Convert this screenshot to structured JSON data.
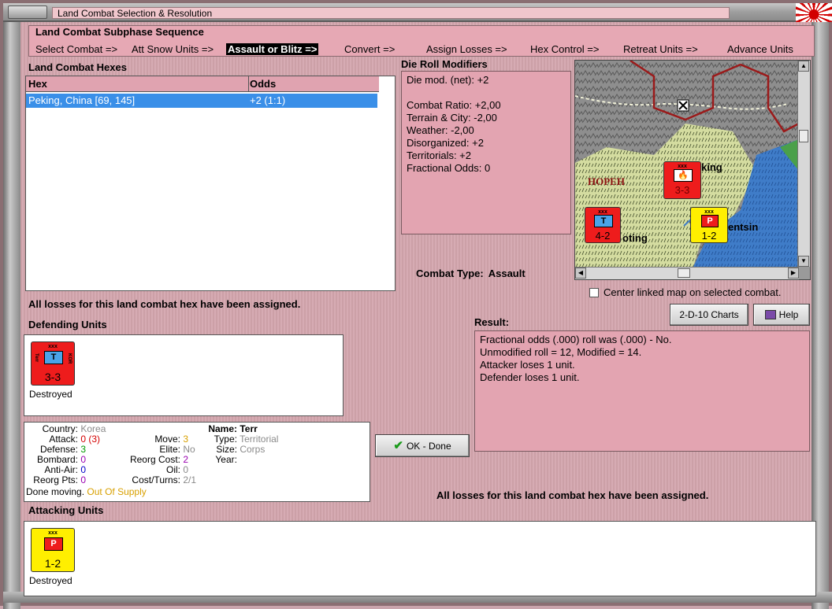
{
  "window": {
    "title": "Land Combat Selection & Resolution"
  },
  "sequence": {
    "title": "Land Combat Subphase Sequence",
    "steps": [
      {
        "label": "Select Combat =>",
        "active": false
      },
      {
        "label": "Att Snow Units =>",
        "active": false
      },
      {
        "label": "Assault or Blitz =>",
        "active": true
      },
      {
        "label": "Convert =>",
        "active": false
      },
      {
        "label": "Assign Losses =>",
        "active": false
      },
      {
        "label": "Hex Control =>",
        "active": false
      },
      {
        "label": "Retreat Units =>",
        "active": false
      },
      {
        "label": "Advance Units",
        "active": false
      }
    ]
  },
  "hexes": {
    "title": "Land Combat Hexes",
    "columns": [
      "Hex",
      "Odds"
    ],
    "rows": [
      {
        "hex": "Peking, China [69, 145]",
        "odds": "+2 (1:1)",
        "selected": true
      }
    ]
  },
  "modifiers": {
    "title": "Die Roll Modifiers",
    "lines": [
      "Die mod. (net): +2",
      "",
      "Combat Ratio: +2,00",
      "Terrain & City: -2,00",
      "Weather: -2,00",
      "Disorganized: +2",
      "Territorials: +2",
      "Fractional Odds: 0"
    ]
  },
  "map": {
    "labels": {
      "hopeh": "HOPEH",
      "peking_partial": "king",
      "tientsin_partial": "entsin",
      "paoting_partial": "oting"
    },
    "units": [
      {
        "type": "T",
        "strength": "3-3",
        "color": "#ee1c1c",
        "burning": true
      },
      {
        "type": "T",
        "strength": "4-2",
        "color": "#ee1c1c",
        "burning": false
      },
      {
        "type": "P",
        "strength": "1-2",
        "color": "#ffef00",
        "burning": false
      }
    ]
  },
  "combat": {
    "type_label": "Combat Type:",
    "type_value": "Assault"
  },
  "center_map_label": "Center linked map on selected combat.",
  "center_map_checked": false,
  "buttons": {
    "charts": "2-D-10 Charts",
    "help": "Help",
    "ok": "OK - Done"
  },
  "status_top": "All losses for this land combat hex have been assigned.",
  "status_bottom": "All losses for this land combat hex have been assigned.",
  "defending": {
    "title": "Defending Units",
    "units": [
      {
        "type": "T",
        "strength": "3-3",
        "size": "xxx",
        "side_left": "Terr",
        "side_right": "KOR",
        "status": "Destroyed",
        "color": "#ee1c1c"
      }
    ]
  },
  "result": {
    "title": "Result:",
    "lines": [
      "Fractional odds (.000) roll was (.000)  - No.",
      "Unmodified roll = 12, Modified = 14.",
      "Attacker loses 1 unit.",
      "Defender loses 1 unit."
    ]
  },
  "unit_info": {
    "country_label": "Country:",
    "country": "Korea",
    "attack_label": "Attack:",
    "attack": "0",
    "attack_extra": "(3)",
    "defense_label": "Defense:",
    "defense": "3",
    "bombard_label": "Bombard:",
    "bombard": "0",
    "antiair_label": "Anti-Air:",
    "antiair": "0",
    "reorgpts_label": "Reorg Pts:",
    "reorgpts": "0",
    "done_label": "Done moving.",
    "supply": "Out Of Supply",
    "move_label": "Move:",
    "move": "3",
    "elite_label": "Elite:",
    "elite": "No",
    "reorgcost_label": "Reorg Cost:",
    "reorgcost": "2",
    "oil_label": "Oil:",
    "oil": "0",
    "costturns_label": "Cost/Turns:",
    "costturns": "2/1",
    "name_label": "Name:",
    "name": "Terr",
    "type_label": "Type:",
    "type": "Territorial",
    "size_label": "Size:",
    "size": "Corps",
    "year_label": "Year:",
    "year": ""
  },
  "attacking": {
    "title": "Attacking Units",
    "units": [
      {
        "type": "P",
        "strength": "1-2",
        "size": "xxx",
        "status": "Destroyed",
        "color": "#ffef00"
      }
    ]
  }
}
